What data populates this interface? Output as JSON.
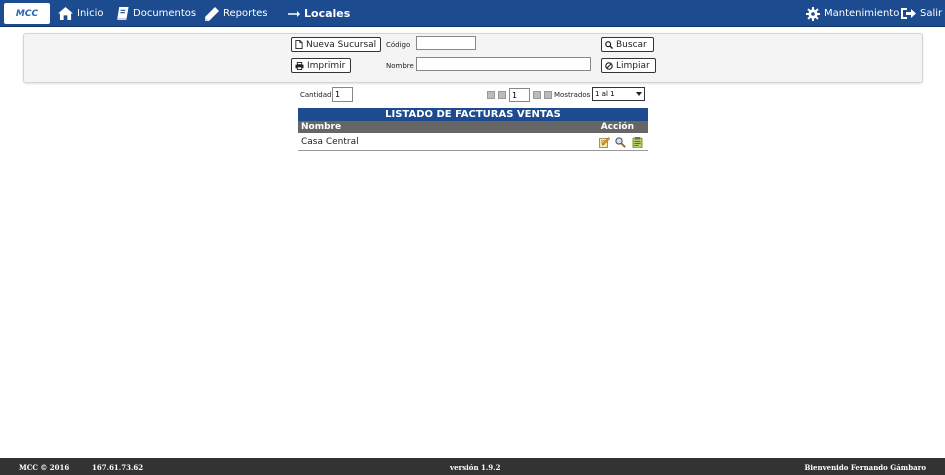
{
  "nav": {
    "logo": "MCC",
    "inicio": "Inicio",
    "documentos": "Documentos",
    "reportes": "Reportes",
    "current": "Locales",
    "mantenimiento": "Mantenimiento",
    "salir": "Salir"
  },
  "filters": {
    "nueva_label": "Nueva Sucursal",
    "imprimir_label": "Imprimir",
    "buscar_label": "Buscar",
    "limpiar_label": "Limpiar",
    "codigo_label": "Código",
    "codigo_value": "",
    "nombre_label": "Nombre",
    "nombre_value": ""
  },
  "paging": {
    "cantidad_label": "Cantidad",
    "cantidad_value": "1",
    "page_value": "1",
    "mostrados_label": "Mostrados",
    "mostrados_value": "1 al 1"
  },
  "listing": {
    "title": "LISTADO DE FACTURAS VENTAS",
    "col_nombre": "Nombre",
    "col_accion": "Acción",
    "rows": [
      {
        "nombre": "Casa Central"
      }
    ]
  },
  "footer": {
    "copyright": "MCC © 2016",
    "brand": "MCC",
    "ip": "167.61.73.62",
    "version": "versión 1.9.2",
    "welcome": "Bienvenido Fernando Gámbaro"
  },
  "colors": {
    "nav_bg": "#1d4b8f",
    "table_head_bg": "#666666",
    "footer_bg": "#333333"
  }
}
